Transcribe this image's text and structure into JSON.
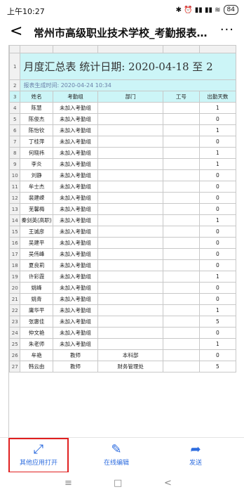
{
  "status": {
    "time": "上午10:27",
    "icons": "✱ ⏰ ▮▮ ▮▮ ≋",
    "battery": "84"
  },
  "header": {
    "title": "常州市高级职业技术学校_考勤报表...",
    "back_glyph": "<",
    "more_glyph": "···"
  },
  "sheet": {
    "row_numbers": [
      "1",
      "2",
      "3",
      "4",
      "5",
      "6",
      "7",
      "8",
      "9",
      "10",
      "11",
      "12",
      "13",
      "14",
      "15",
      "16",
      "17",
      "18",
      "19",
      "20",
      "21",
      "22",
      "23",
      "24",
      "25",
      "26",
      "27"
    ],
    "title": "月度汇总表  统计日期: 2020-04-18  至  2",
    "generated": "报表生成时间: 2020-04-24 10:34",
    "columns": [
      "姓名",
      "考勤组",
      "部门",
      "工号",
      "出勤天数"
    ],
    "rows": [
      [
        "陈慧",
        "未加入考勤组",
        "",
        "",
        "1"
      ],
      [
        "陈俊杰",
        "未加入考勤组",
        "",
        "",
        "0"
      ],
      [
        "陈怡钦",
        "未加入考勤组",
        "",
        "",
        "1"
      ],
      [
        "丁桂萍",
        "未加入考勤组",
        "",
        "",
        "0"
      ],
      [
        "何晓祎",
        "未加入考勤组",
        "",
        "",
        "1"
      ],
      [
        "李炎",
        "未加入考勤组",
        "",
        "",
        "1"
      ],
      [
        "刘静",
        "未加入考勤组",
        "",
        "",
        "0"
      ],
      [
        "牟士杰",
        "未加入考勤组",
        "",
        "",
        "0"
      ],
      [
        "裴建嵘",
        "未加入考勤组",
        "",
        "",
        "0"
      ],
      [
        "芜馨梅",
        "未加入考勤组",
        "",
        "",
        "0"
      ],
      [
        "秦剑英(高职)",
        "未加入考勤组",
        "",
        "",
        "1"
      ],
      [
        "王诚彦",
        "未加入考勤组",
        "",
        "",
        "0"
      ],
      [
        "吴建平",
        "未加入考勤组",
        "",
        "",
        "0"
      ],
      [
        "吴伟峰",
        "未加入考勤组",
        "",
        "",
        "0"
      ],
      [
        "夏良莉",
        "未加入考勤组",
        "",
        "",
        "0"
      ],
      [
        "许彩霞",
        "未加入考勤组",
        "",
        "",
        "1"
      ],
      [
        "姚峰",
        "未加入考勤组",
        "",
        "",
        "0"
      ],
      [
        "姚青",
        "未加入考勤组",
        "",
        "",
        "0"
      ],
      [
        "庸华平",
        "未加入考勤组",
        "",
        "",
        "1"
      ],
      [
        "张惠佳",
        "未加入考勤组",
        "",
        "",
        "5"
      ],
      [
        "仲文艳",
        "未加入考勤组",
        "",
        "",
        "0"
      ],
      [
        "朱老师",
        "未加入考勤组",
        "",
        "",
        "1"
      ],
      [
        "牟艳",
        "教师",
        "本科部",
        "",
        "0"
      ],
      [
        "韩云由",
        "教师",
        "财务管理处",
        "",
        "5"
      ]
    ]
  },
  "actions": [
    {
      "label": "其他应用打开",
      "icon": "⤢"
    },
    {
      "label": "在线编辑",
      "icon": "✎"
    },
    {
      "label": "发送",
      "icon": "➦"
    }
  ],
  "nav": {
    "menu": "≡",
    "home": "□",
    "back": "<"
  },
  "colors": {
    "accent": "#2d6cdf",
    "sheet_highlight": "#ccf5f7",
    "marker": "#e02020"
  }
}
